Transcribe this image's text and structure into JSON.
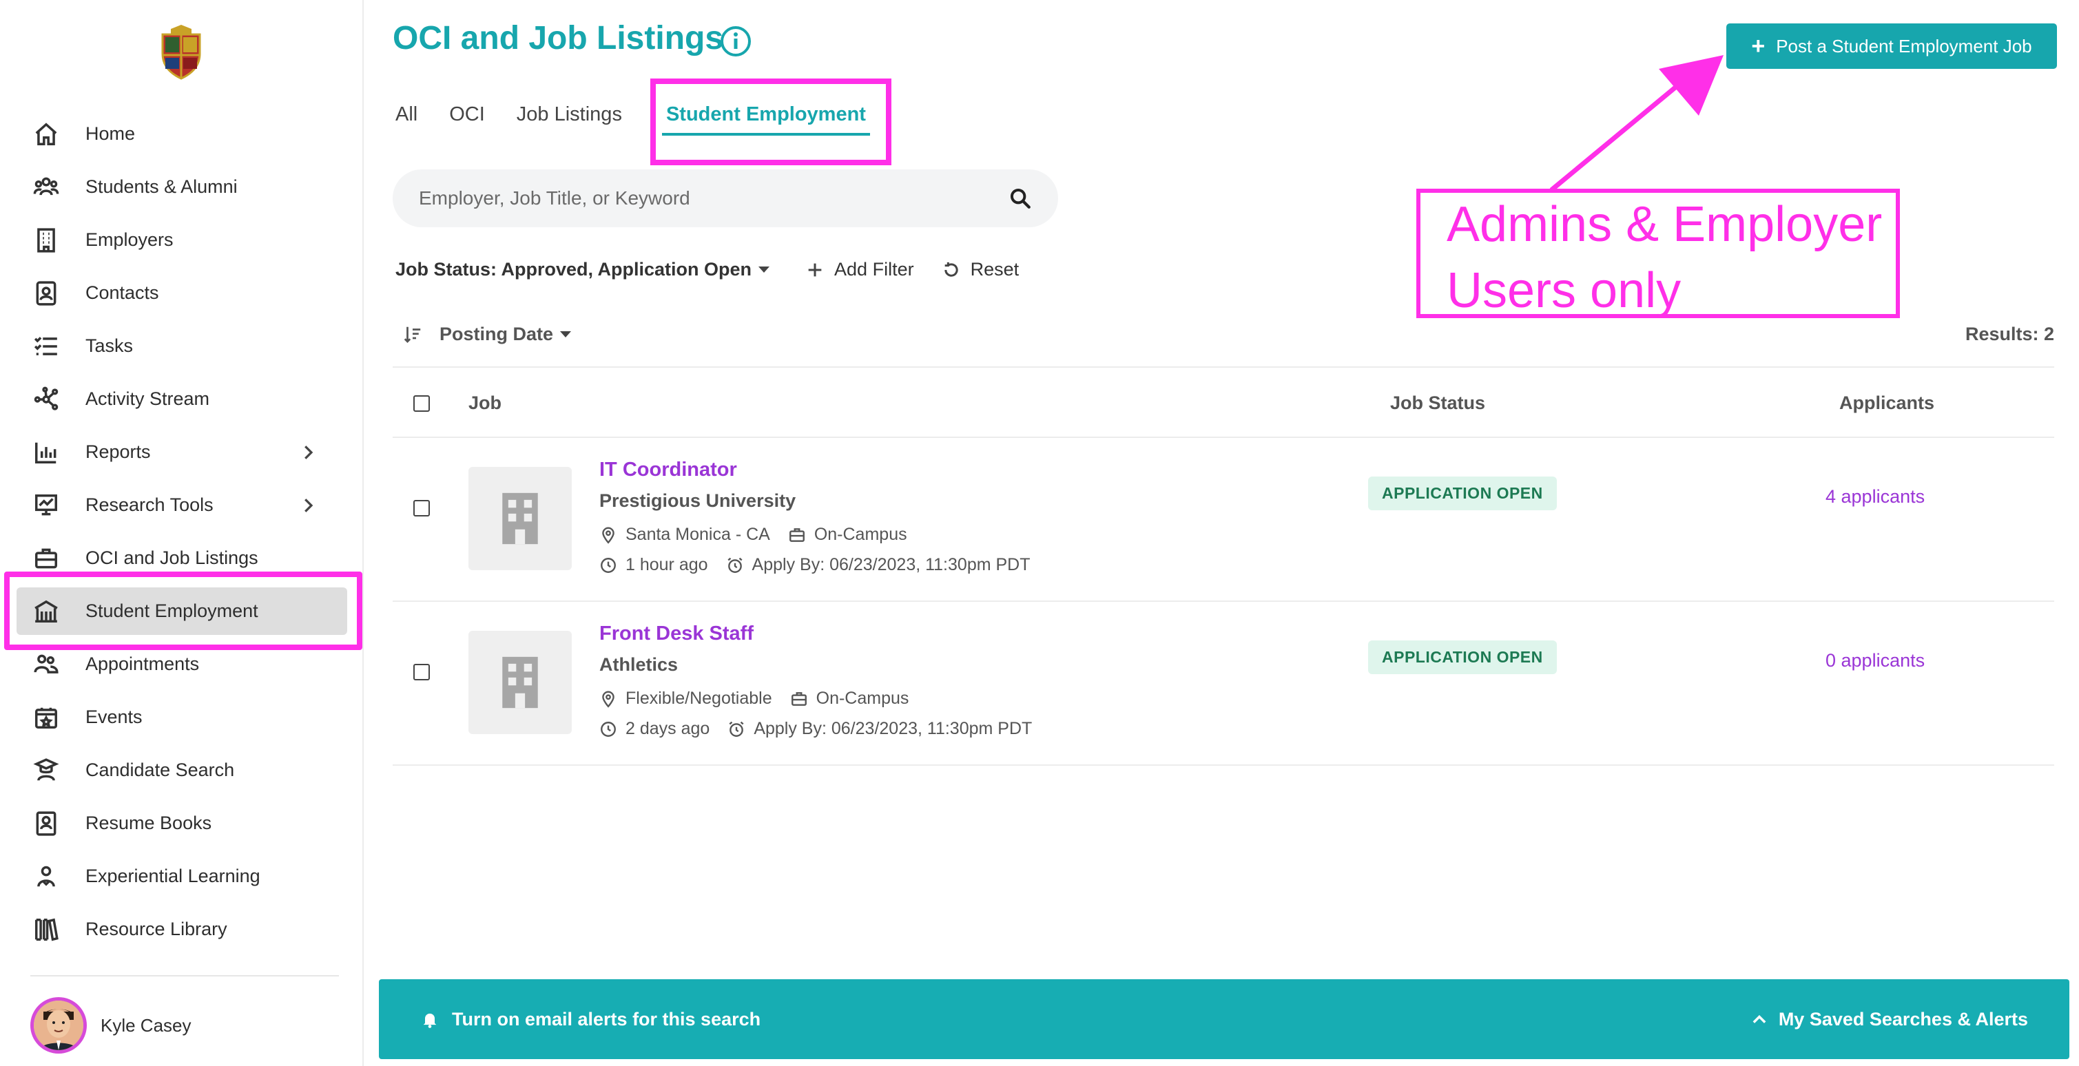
{
  "page": {
    "title": "OCI and Job Listings",
    "colors": {
      "accent": "#17a6ad",
      "link": "#9a35d6",
      "highlight": "#ff2fe8",
      "badge_bg": "#dff5ec",
      "badge_text": "#1d7a53"
    }
  },
  "sidebar": {
    "items": [
      {
        "label": "Home",
        "icon": "home-icon"
      },
      {
        "label": "Students & Alumni",
        "icon": "people-icon"
      },
      {
        "label": "Employers",
        "icon": "building-icon"
      },
      {
        "label": "Contacts",
        "icon": "contact-card-icon"
      },
      {
        "label": "Tasks",
        "icon": "checklist-icon"
      },
      {
        "label": "Activity Stream",
        "icon": "network-icon"
      },
      {
        "label": "Reports",
        "icon": "bar-chart-icon",
        "expandable": true
      },
      {
        "label": "Research Tools",
        "icon": "research-chart-icon",
        "expandable": true
      },
      {
        "label": "OCI and Job Listings",
        "icon": "briefcase-icon"
      },
      {
        "label": "Student Employment",
        "icon": "campus-building-icon",
        "active": true
      },
      {
        "label": "Appointments",
        "icon": "appointments-icon"
      },
      {
        "label": "Events",
        "icon": "calendar-star-icon"
      },
      {
        "label": "Candidate Search",
        "icon": "graduate-search-icon"
      },
      {
        "label": "Resume Books",
        "icon": "resume-book-icon"
      },
      {
        "label": "Experiential Learning",
        "icon": "learner-icon"
      },
      {
        "label": "Resource Library",
        "icon": "library-books-icon"
      }
    ],
    "user": {
      "name": "Kyle Casey"
    }
  },
  "tabs": [
    {
      "label": "All"
    },
    {
      "label": "OCI"
    },
    {
      "label": "Job Listings"
    },
    {
      "label": "Student Employment",
      "active": true
    }
  ],
  "search": {
    "placeholder": "Employer, Job Title, or Keyword",
    "value": ""
  },
  "filters": {
    "status_label": "Job Status: Approved, Application Open",
    "add_filter": "Add Filter",
    "reset": "Reset"
  },
  "sort": {
    "label": "Posting Date",
    "results": "Results: 2"
  },
  "table": {
    "columns": {
      "job": "Job",
      "status": "Job Status",
      "applicants": "Applicants"
    },
    "rows": [
      {
        "title": "IT Coordinator",
        "employer": "Prestigious University",
        "location": "Santa Monica - CA",
        "work_type": "On-Campus",
        "posted": "1 hour ago",
        "apply_by": "Apply By: 06/23/2023, 11:30pm PDT",
        "status": "APPLICATION OPEN",
        "applicants": "4 applicants"
      },
      {
        "title": "Front Desk Staff",
        "employer": "Athletics",
        "location": "Flexible/Negotiable",
        "work_type": "On-Campus",
        "posted": "2 days ago",
        "apply_by": "Apply By: 06/23/2023, 11:30pm PDT",
        "status": "APPLICATION OPEN",
        "applicants": "0 applicants"
      }
    ]
  },
  "actions": {
    "post_job": "Post a Student Employment Job"
  },
  "annotation": {
    "line1": "Admins & Employer",
    "line2": "Users only"
  },
  "alert_bar": {
    "left": "Turn on email alerts for this search",
    "right": "My Saved Searches & Alerts"
  }
}
